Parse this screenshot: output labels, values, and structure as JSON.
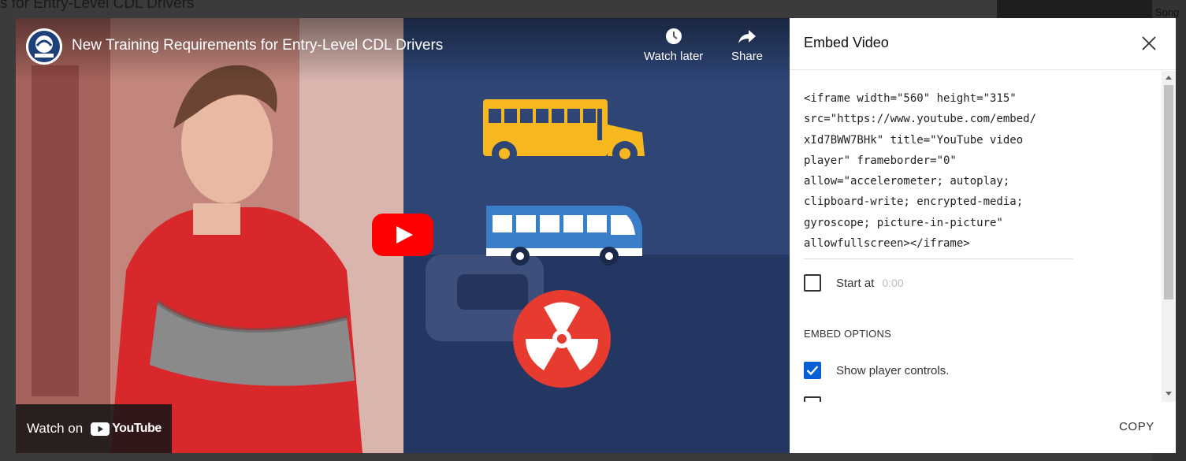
{
  "background": {
    "partial_title": "s for Entry-Level CDL Drivers",
    "right_label": "Song"
  },
  "video": {
    "title": "New Training Requirements for Entry-Level CDL Drivers",
    "channel_logo_text": "FMCSA",
    "watch_later_label": "Watch later",
    "share_label": "Share",
    "watch_on_label": "Watch on",
    "youtube_wordmark": "YouTube",
    "colors": {
      "play": "#ff0000",
      "bus_yellow": "#f7b81f",
      "bus_blue": "#3a7dc9",
      "hazmat_red": "#e63b2e"
    }
  },
  "embed_panel": {
    "title": "Embed Video",
    "code_lines": [
      "<iframe width=\"560\" height=\"315\"",
      "src=\"https://www.youtube.com/embed/",
      "xId7BWW7BHk\" title=\"YouTube video",
      "player\" frameborder=\"0\"",
      "allow=\"accelerometer; autoplay;",
      "clipboard-write; encrypted-media;",
      "gyroscope; picture-in-picture\"",
      "allowfullscreen></iframe>"
    ],
    "start_at_label": "Start at",
    "start_at_value": "0:00",
    "start_at_checked": false,
    "embed_options_heading": "EMBED OPTIONS",
    "show_controls_label": "Show player controls.",
    "show_controls_checked": true,
    "copy_label": "COPY",
    "accent_color": "#065fd4"
  }
}
